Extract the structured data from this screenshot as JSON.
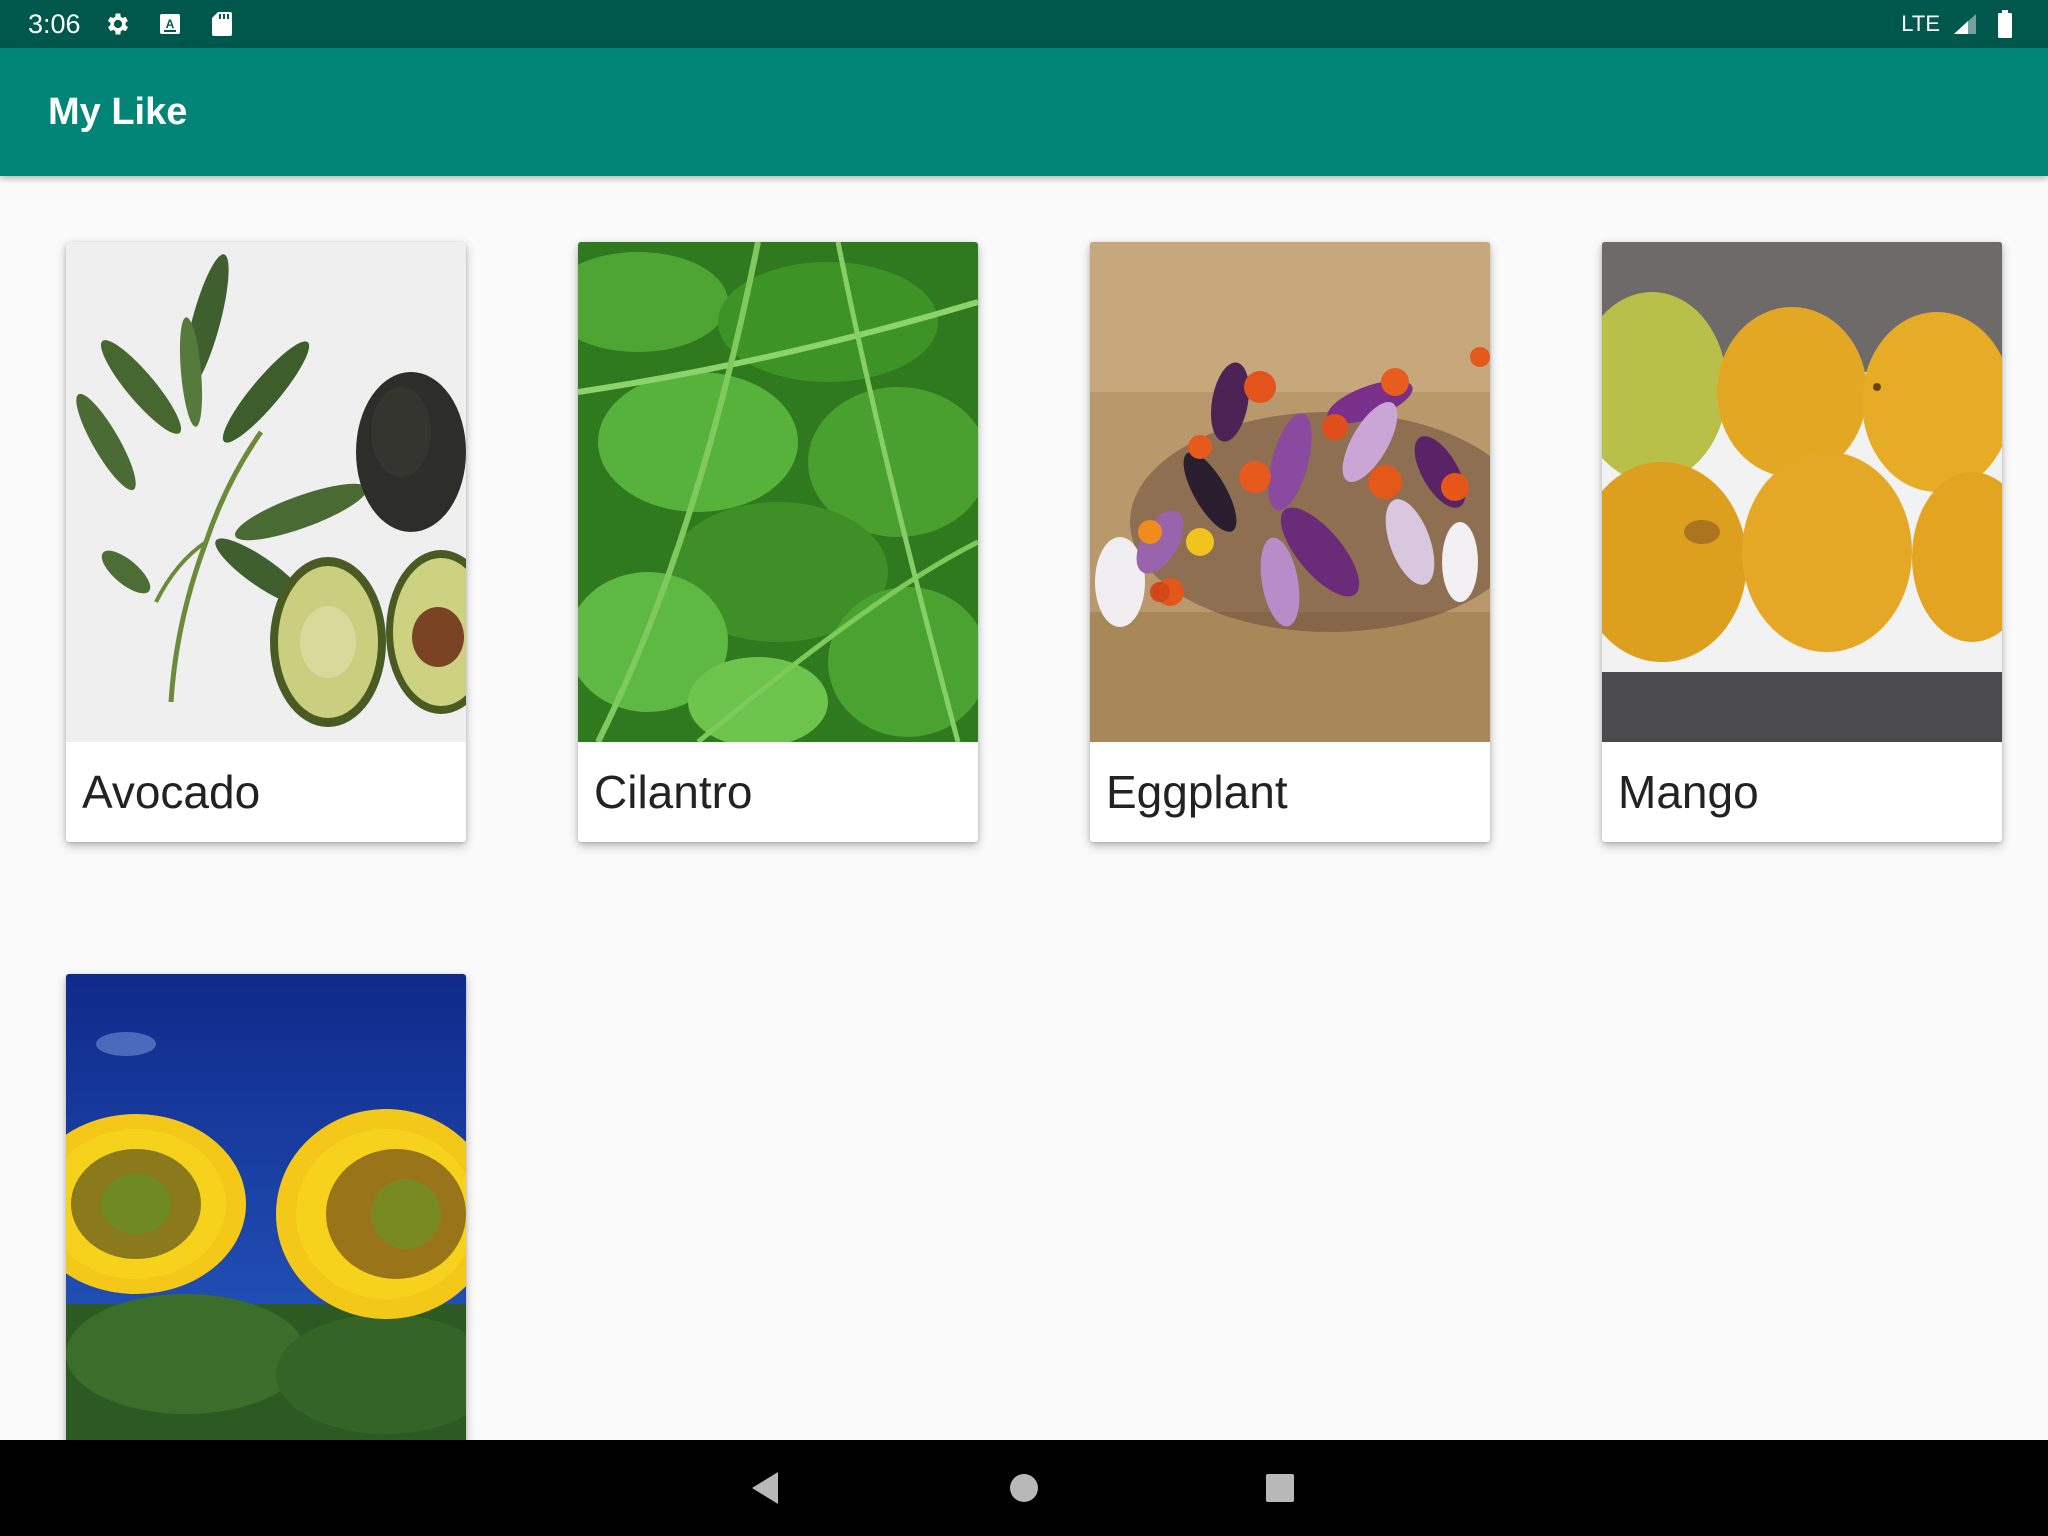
{
  "status_bar": {
    "time": "3:06",
    "network": "LTE",
    "icons": [
      "settings-icon",
      "a-icon",
      "sd-card-icon",
      "signal-icon",
      "battery-icon"
    ]
  },
  "app_bar": {
    "title": "My Like",
    "color": "#008577"
  },
  "items": [
    {
      "label": "Avocado",
      "image": "avocado-photo"
    },
    {
      "label": "Cilantro",
      "image": "cilantro-photo"
    },
    {
      "label": "Eggplant",
      "image": "eggplant-photo"
    },
    {
      "label": "Mango",
      "image": "mango-photo"
    },
    {
      "label": "",
      "image": "sunflower-photo"
    }
  ],
  "nav_bar": {
    "icons": [
      "back-icon",
      "home-icon",
      "recents-icon"
    ]
  }
}
